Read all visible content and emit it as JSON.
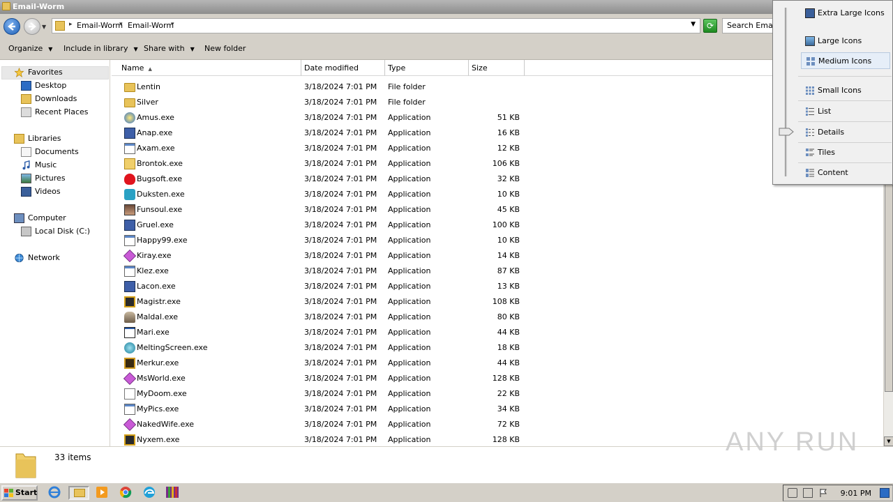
{
  "window": {
    "title": "Email-Worm"
  },
  "address": {
    "crumbs": [
      "Email-Worm",
      "Email-Worm"
    ],
    "search_placeholder": "Search Email-Worm"
  },
  "toolbar": {
    "organize": "Organize",
    "include_in_library": "Include in library",
    "share_with": "Share with",
    "new_folder": "New folder"
  },
  "navpane": {
    "favorites": "Favorites",
    "favorites_items": [
      "Desktop",
      "Downloads",
      "Recent Places"
    ],
    "libraries": "Libraries",
    "libraries_items": [
      "Documents",
      "Music",
      "Pictures",
      "Videos"
    ],
    "computer": "Computer",
    "computer_items": [
      "Local Disk (C:)"
    ],
    "network": "Network"
  },
  "columns": {
    "name": "Name",
    "date": "Date modified",
    "type": "Type",
    "size": "Size"
  },
  "files": [
    {
      "name": "Lentin",
      "date": "3/18/2024 7:01 PM",
      "type": "File folder",
      "size": "",
      "icon": "folder-icon"
    },
    {
      "name": "Silver",
      "date": "3/18/2024 7:01 PM",
      "type": "File folder",
      "size": "",
      "icon": "folder-icon"
    },
    {
      "name": "Amus.exe",
      "date": "3/18/2024 7:01 PM",
      "type": "Application",
      "size": "51 KB",
      "icon": "globe-app-icon"
    },
    {
      "name": "Anap.exe",
      "date": "3/18/2024 7:01 PM",
      "type": "Application",
      "size": "16 KB",
      "icon": "computer-app-icon"
    },
    {
      "name": "Axam.exe",
      "date": "3/18/2024 7:01 PM",
      "type": "Application",
      "size": "12 KB",
      "icon": "window-app-icon"
    },
    {
      "name": "Brontok.exe",
      "date": "3/18/2024 7:01 PM",
      "type": "Application",
      "size": "106 KB",
      "icon": "folder-app-icon"
    },
    {
      "name": "Bugsoft.exe",
      "date": "3/18/2024 7:01 PM",
      "type": "Application",
      "size": "32 KB",
      "icon": "heart-app-icon"
    },
    {
      "name": "Duksten.exe",
      "date": "3/18/2024 7:01 PM",
      "type": "Application",
      "size": "10 KB",
      "icon": "network-app-icon"
    },
    {
      "name": "Funsoul.exe",
      "date": "3/18/2024 7:01 PM",
      "type": "Application",
      "size": "45 KB",
      "icon": "photo-app-icon"
    },
    {
      "name": "Gruel.exe",
      "date": "3/18/2024 7:01 PM",
      "type": "Application",
      "size": "100 KB",
      "icon": "computer-app-icon"
    },
    {
      "name": "Happy99.exe",
      "date": "3/18/2024 7:01 PM",
      "type": "Application",
      "size": "10 KB",
      "icon": "window-app-icon"
    },
    {
      "name": "Kiray.exe",
      "date": "3/18/2024 7:01 PM",
      "type": "Application",
      "size": "14 KB",
      "icon": "diamond-app-icon"
    },
    {
      "name": "Klez.exe",
      "date": "3/18/2024 7:01 PM",
      "type": "Application",
      "size": "87 KB",
      "icon": "window-app-icon"
    },
    {
      "name": "Lacon.exe",
      "date": "3/18/2024 7:01 PM",
      "type": "Application",
      "size": "13 KB",
      "icon": "computer-app-icon"
    },
    {
      "name": "Magistr.exe",
      "date": "3/18/2024 7:01 PM",
      "type": "Application",
      "size": "108 KB",
      "icon": "monitor-app-icon"
    },
    {
      "name": "Maldal.exe",
      "date": "3/18/2024 7:01 PM",
      "type": "Application",
      "size": "80 KB",
      "icon": "figure-app-icon"
    },
    {
      "name": "Mari.exe",
      "date": "3/18/2024 7:01 PM",
      "type": "Application",
      "size": "44 KB",
      "icon": "blank-window-icon"
    },
    {
      "name": "MeltingScreen.exe",
      "date": "3/18/2024 7:01 PM",
      "type": "Application",
      "size": "18 KB",
      "icon": "snowflake-app-icon"
    },
    {
      "name": "Merkur.exe",
      "date": "3/18/2024 7:01 PM",
      "type": "Application",
      "size": "44 KB",
      "icon": "box-app-icon"
    },
    {
      "name": "MsWorld.exe",
      "date": "3/18/2024 7:01 PM",
      "type": "Application",
      "size": "128 KB",
      "icon": "diamond-app-icon"
    },
    {
      "name": "MyDoom.exe",
      "date": "3/18/2024 7:01 PM",
      "type": "Application",
      "size": "22 KB",
      "icon": "document-app-icon"
    },
    {
      "name": "MyPics.exe",
      "date": "3/18/2024 7:01 PM",
      "type": "Application",
      "size": "34 KB",
      "icon": "window-app-icon"
    },
    {
      "name": "NakedWife.exe",
      "date": "3/18/2024 7:01 PM",
      "type": "Application",
      "size": "72 KB",
      "icon": "diamond-app-icon"
    },
    {
      "name": "Nyxem.exe",
      "date": "3/18/2024 7:01 PM",
      "type": "Application",
      "size": "128 KB",
      "icon": "monitor-app-icon"
    }
  ],
  "status": {
    "item_count": "33 items",
    "watermark": "ANY RUN"
  },
  "view_menu": {
    "items": [
      "Extra Large Icons",
      "Large Icons",
      "Medium Icons",
      "Small Icons",
      "List",
      "Details",
      "Tiles",
      "Content"
    ],
    "selected": "Medium Icons",
    "slider_position": "Details"
  },
  "taskbar": {
    "start": "Start",
    "clock": "9:01 PM"
  },
  "colors": {
    "accent": "#1d5fb5",
    "folder": "#e8c35a",
    "selection": "#e6eef8"
  }
}
